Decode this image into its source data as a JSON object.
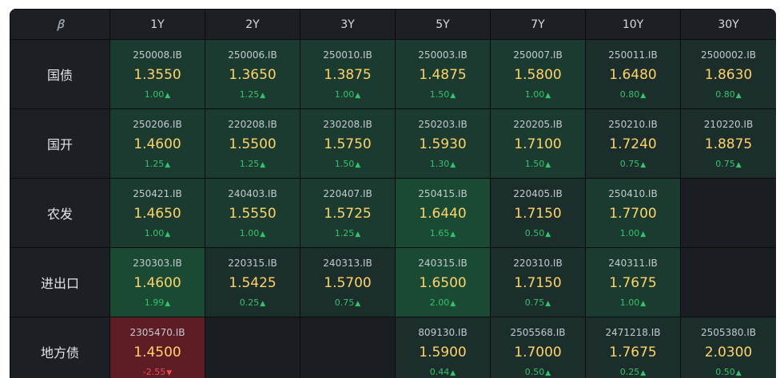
{
  "logo_text": "ꞵ",
  "columns": [
    "1Y",
    "2Y",
    "3Y",
    "5Y",
    "7Y",
    "10Y",
    "30Y"
  ],
  "rows": [
    {
      "label": "国债",
      "cells": [
        {
          "code": "250008.IB",
          "yield": "1.3550",
          "change": "1.00",
          "dir": "up",
          "tone": "mid"
        },
        {
          "code": "250006.IB",
          "yield": "1.3650",
          "change": "1.25",
          "dir": "up",
          "tone": "mid"
        },
        {
          "code": "250010.IB",
          "yield": "1.3875",
          "change": "1.00",
          "dir": "up",
          "tone": "mid"
        },
        {
          "code": "250003.IB",
          "yield": "1.4875",
          "change": "1.50",
          "dir": "up",
          "tone": "mid"
        },
        {
          "code": "250007.IB",
          "yield": "1.5800",
          "change": "1.00",
          "dir": "up",
          "tone": "mid"
        },
        {
          "code": "250011.IB",
          "yield": "1.6480",
          "change": "0.80",
          "dir": "up",
          "tone": "low"
        },
        {
          "code": "2500002.IB",
          "yield": "1.8630",
          "change": "0.80",
          "dir": "up",
          "tone": "low"
        }
      ]
    },
    {
      "label": "国开",
      "cells": [
        {
          "code": "250206.IB",
          "yield": "1.4600",
          "change": "1.25",
          "dir": "up",
          "tone": "mid"
        },
        {
          "code": "220208.IB",
          "yield": "1.5500",
          "change": "1.25",
          "dir": "up",
          "tone": "mid"
        },
        {
          "code": "230208.IB",
          "yield": "1.5750",
          "change": "1.50",
          "dir": "up",
          "tone": "mid"
        },
        {
          "code": "250203.IB",
          "yield": "1.5930",
          "change": "1.30",
          "dir": "up",
          "tone": "mid"
        },
        {
          "code": "220205.IB",
          "yield": "1.7100",
          "change": "1.50",
          "dir": "up",
          "tone": "mid"
        },
        {
          "code": "250210.IB",
          "yield": "1.7240",
          "change": "0.75",
          "dir": "up",
          "tone": "low"
        },
        {
          "code": "210220.IB",
          "yield": "1.8875",
          "change": "0.75",
          "dir": "up",
          "tone": "low"
        }
      ]
    },
    {
      "label": "农发",
      "cells": [
        {
          "code": "250421.IB",
          "yield": "1.4650",
          "change": "1.00",
          "dir": "up",
          "tone": "mid"
        },
        {
          "code": "240403.IB",
          "yield": "1.5550",
          "change": "1.00",
          "dir": "up",
          "tone": "mid"
        },
        {
          "code": "220407.IB",
          "yield": "1.5725",
          "change": "1.25",
          "dir": "up",
          "tone": "mid"
        },
        {
          "code": "250415.IB",
          "yield": "1.6440",
          "change": "1.65",
          "dir": "up",
          "tone": "high"
        },
        {
          "code": "220405.IB",
          "yield": "1.7150",
          "change": "0.50",
          "dir": "up",
          "tone": "low"
        },
        {
          "code": "250410.IB",
          "yield": "1.7700",
          "change": "1.00",
          "dir": "up",
          "tone": "mid"
        },
        null
      ]
    },
    {
      "label": "进出口",
      "cells": [
        {
          "code": "230303.IB",
          "yield": "1.4600",
          "change": "1.99",
          "dir": "up",
          "tone": "high"
        },
        {
          "code": "220315.IB",
          "yield": "1.5425",
          "change": "0.25",
          "dir": "up",
          "tone": "low"
        },
        {
          "code": "240313.IB",
          "yield": "1.5700",
          "change": "0.75",
          "dir": "up",
          "tone": "low"
        },
        {
          "code": "240315.IB",
          "yield": "1.6500",
          "change": "2.00",
          "dir": "up",
          "tone": "high"
        },
        {
          "code": "220310.IB",
          "yield": "1.7150",
          "change": "0.75",
          "dir": "up",
          "tone": "low"
        },
        {
          "code": "240311.IB",
          "yield": "1.7675",
          "change": "1.00",
          "dir": "up",
          "tone": "mid"
        },
        null
      ]
    },
    {
      "label": "地方债",
      "cells": [
        {
          "code": "2305470.IB",
          "yield": "1.4500",
          "change": "-2.55",
          "dir": "down",
          "tone": "neg"
        },
        null,
        null,
        {
          "code": "809130.IB",
          "yield": "1.5900",
          "change": "0.44",
          "dir": "up",
          "tone": "low"
        },
        {
          "code": "2505568.IB",
          "yield": "1.7000",
          "change": "0.50",
          "dir": "up",
          "tone": "low"
        },
        {
          "code": "2471218.IB",
          "yield": "1.7675",
          "change": "0.25",
          "dir": "up",
          "tone": "low"
        },
        {
          "code": "2505380.IB",
          "yield": "2.0300",
          "change": "0.50",
          "dir": "up",
          "tone": "low"
        }
      ]
    }
  ],
  "colors": {
    "up": "#34c36c",
    "down": "#ef4b5a",
    "yield": "#ffd36a",
    "background": "#16191d"
  },
  "icons": {
    "up": "triangle-up",
    "down": "triangle-down"
  }
}
